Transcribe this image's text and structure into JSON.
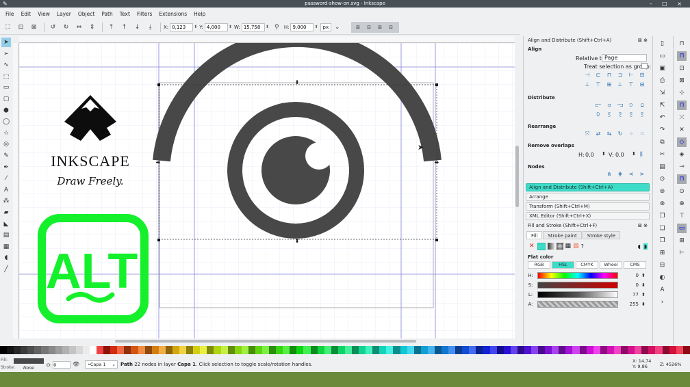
{
  "window": {
    "title": "password-show-on.svg - Inkscape",
    "controls": "– □ ×"
  },
  "menu": [
    "File",
    "Edit",
    "View",
    "Layer",
    "Object",
    "Path",
    "Text",
    "Filters",
    "Extensions",
    "Help"
  ],
  "toolbar": {
    "x_label": "X:",
    "x_value": "0,123",
    "y_label": "Y:",
    "y_value": "4,000",
    "w_label": "W:",
    "w_value": "15,758",
    "h_label": "H:",
    "h_value": "9,000",
    "unit": "px"
  },
  "canvas_logo": {
    "wordmark": "INKSCAPE",
    "tagline": "Draw Freely.",
    "alt_text": "ALT"
  },
  "dock": {
    "align_panel_title": "Align and Distribute (Shift+Ctrl+A)",
    "align_heading": "Align",
    "relative_to_label": "Relative to:",
    "relative_to_value": "Page",
    "treat_group_label": "Treat selection as group:",
    "distribute_heading": "Distribute",
    "rearrange_heading": "Rearrange",
    "remove_overlaps_heading": "Remove overlaps",
    "overlap_h_label": "H:",
    "overlap_h_value": "0,0",
    "overlap_v_label": "V:",
    "overlap_v_value": "0,0",
    "nodes_heading": "Nodes",
    "collapsed_panels": [
      "Align and Distribute (Shift+Ctrl+A)",
      "Arrange",
      "Transform (Shift+Ctrl+M)",
      "XML Editor (Shift+Ctrl+X)"
    ],
    "fill_stroke_title": "Fill and Stroke (Shift+Ctrl+F)",
    "tabs": [
      "Fill",
      "Stroke paint",
      "Stroke style"
    ],
    "flat_color_label": "Flat color",
    "color_modes": [
      "RGB",
      "HSL",
      "CMYK",
      "Wheel",
      "CMS"
    ],
    "sliders": [
      {
        "label": "H:",
        "value": "0"
      },
      {
        "label": "S:",
        "value": "0"
      },
      {
        "label": "L:",
        "value": "77"
      },
      {
        "label": "A:",
        "value": "255"
      }
    ]
  },
  "status": {
    "fill_label": "Fill:",
    "stroke_label": "Stroke:",
    "stroke_value": "None",
    "opacity_label": "O:",
    "opacity_value": "0",
    "layer": "•Capa 1",
    "message_bold": "Path",
    "message_pre": " 22 nodes in layer ",
    "message_layer": "Capa 1",
    "message_post": ". Click selection to toggle scale/rotation handles.",
    "x_label": "X:",
    "x_value": "14,74",
    "y_label": "Y:",
    "y_value": "9,86",
    "zoom_label": "Z:",
    "zoom_value": "4526%"
  },
  "colors": {
    "accent": "#3ddcc8",
    "alt_green": "#14f02c",
    "eye_gray": "#484848",
    "selection": "#93cee9"
  }
}
